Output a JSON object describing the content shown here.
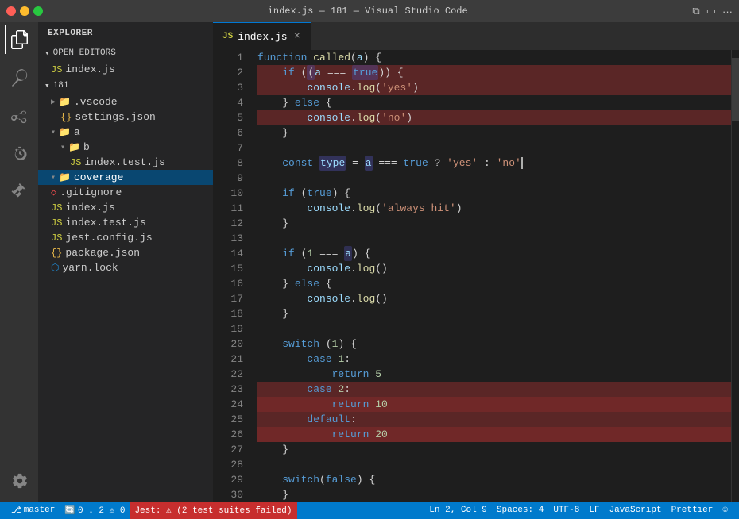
{
  "titleBar": {
    "title": "index.js — 181 — Visual Studio Code",
    "buttons": [
      "close",
      "minimize",
      "maximize"
    ]
  },
  "activityBar": {
    "icons": [
      {
        "name": "explorer-icon",
        "symbol": "⎘",
        "active": true
      },
      {
        "name": "search-icon",
        "symbol": "🔍",
        "active": false
      },
      {
        "name": "source-control-icon",
        "symbol": "⑂",
        "active": false
      },
      {
        "name": "debug-icon",
        "symbol": "▷",
        "active": false
      },
      {
        "name": "extensions-icon",
        "symbol": "⊞",
        "active": false
      },
      {
        "name": "settings-icon",
        "symbol": "⚙",
        "active": false
      }
    ]
  },
  "sidebar": {
    "header": "Explorer",
    "openEditors": {
      "label": "Open Editors",
      "files": [
        {
          "name": "index.js",
          "icon": "js"
        }
      ]
    },
    "tree": {
      "root": "181",
      "items": [
        {
          "label": ".vscode",
          "type": "folder",
          "indent": 1,
          "collapsed": true
        },
        {
          "label": "settings.json",
          "type": "json",
          "indent": 2
        },
        {
          "label": "a",
          "type": "folder",
          "indent": 1
        },
        {
          "label": "b",
          "type": "folder",
          "indent": 2
        },
        {
          "label": "index.test.js",
          "type": "js",
          "indent": 3
        },
        {
          "label": "coverage",
          "type": "folder",
          "indent": 1,
          "active": true
        },
        {
          "label": ".gitignore",
          "type": "git",
          "indent": 2
        },
        {
          "label": "index.js",
          "type": "js",
          "indent": 2
        },
        {
          "label": "index.test.js",
          "type": "js",
          "indent": 2
        },
        {
          "label": "jest.config.js",
          "type": "js",
          "indent": 2
        },
        {
          "label": "package.json",
          "type": "json",
          "indent": 2
        },
        {
          "label": "yarn.lock",
          "type": "yarn",
          "indent": 2
        }
      ]
    }
  },
  "editor": {
    "filename": "index.js",
    "lines": [
      {
        "num": 1,
        "content": "function called(a) {",
        "covered": false
      },
      {
        "num": 2,
        "content": "    if ((a === true)) {",
        "covered": "miss"
      },
      {
        "num": 3,
        "content": "        console.log('yes')",
        "covered": "miss"
      },
      {
        "num": 4,
        "content": "    } else {",
        "covered": false
      },
      {
        "num": 5,
        "content": "        console.log('no')",
        "covered": "miss"
      },
      {
        "num": 6,
        "content": "    }",
        "covered": false
      },
      {
        "num": 7,
        "content": "",
        "covered": false
      },
      {
        "num": 8,
        "content": "    const type = a === true ? 'yes' : 'no'",
        "covered": false
      },
      {
        "num": 9,
        "content": "",
        "covered": false
      },
      {
        "num": 10,
        "content": "    if (true) {",
        "covered": false
      },
      {
        "num": 11,
        "content": "        console.log('always hit')",
        "covered": false
      },
      {
        "num": 12,
        "content": "    }",
        "covered": false
      },
      {
        "num": 13,
        "content": "",
        "covered": false
      },
      {
        "num": 14,
        "content": "    if (1 === a) {",
        "covered": false
      },
      {
        "num": 15,
        "content": "        console.log()",
        "covered": false
      },
      {
        "num": 16,
        "content": "    } else {",
        "covered": false
      },
      {
        "num": 17,
        "content": "        console.log()",
        "covered": false
      },
      {
        "num": 18,
        "content": "    }",
        "covered": false
      },
      {
        "num": 19,
        "content": "",
        "covered": false
      },
      {
        "num": 20,
        "content": "    switch (1) {",
        "covered": false
      },
      {
        "num": 21,
        "content": "        case 1:",
        "covered": false
      },
      {
        "num": 22,
        "content": "            return 5",
        "covered": false
      },
      {
        "num": 23,
        "content": "        case 2:",
        "covered": "miss"
      },
      {
        "num": 24,
        "content": "            return 10",
        "covered": "miss-full"
      },
      {
        "num": 25,
        "content": "        default:",
        "covered": "miss"
      },
      {
        "num": 26,
        "content": "            return 20",
        "covered": "miss-full"
      },
      {
        "num": 27,
        "content": "    }",
        "covered": false
      },
      {
        "num": 28,
        "content": "",
        "covered": false
      },
      {
        "num": 29,
        "content": "    switch(false) {",
        "covered": false
      },
      {
        "num": 30,
        "content": "    }",
        "covered": false
      }
    ]
  },
  "statusBar": {
    "branch": "master",
    "sync": "0 ↓ 2 ⚠ 0",
    "jest": "Jest: ⚠ (2 test suites failed)",
    "position": "Ln 2, Col 9",
    "spaces": "Spaces: 4",
    "encoding": "UTF-8",
    "lineEnding": "LF",
    "language": "JavaScript",
    "formatter": "Prettier",
    "feedback": "☺"
  }
}
